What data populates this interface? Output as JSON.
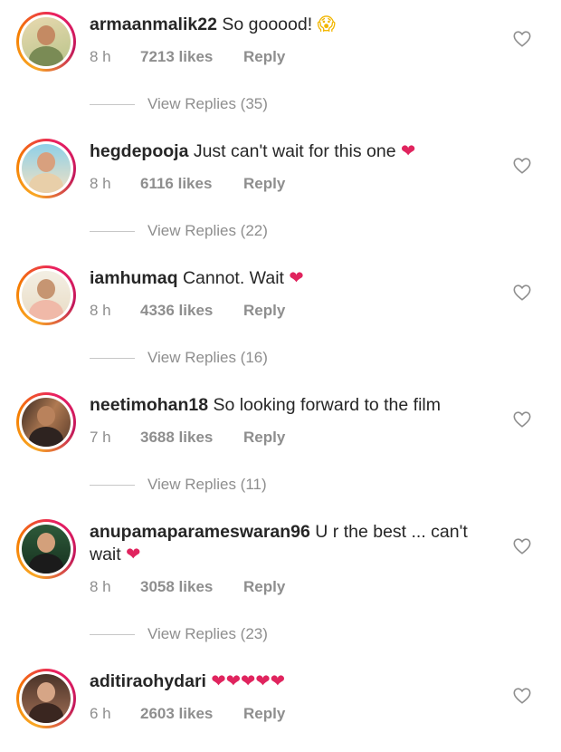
{
  "colors": {
    "heart": "#e0245e",
    "meta": "#8e8e8e",
    "text": "#262626"
  },
  "comments": [
    {
      "username": "armaanmalik22",
      "text": " So gooood! ",
      "emoji": "😱",
      "time": "8 h",
      "likes": "7213 likes",
      "reply": "Reply",
      "view_replies": "View Replies (35)"
    },
    {
      "username": "hegdepooja",
      "text": " Just can't wait for this one ",
      "emoji": "❤",
      "time": "8 h",
      "likes": "6116 likes",
      "reply": "Reply",
      "view_replies": "View Replies (22)"
    },
    {
      "username": "iamhumaq",
      "text": " Cannot. Wait ",
      "emoji": "❤",
      "time": "8 h",
      "likes": "4336 likes",
      "reply": "Reply",
      "view_replies": "View Replies (16)"
    },
    {
      "username": "neetimohan18",
      "text": " So looking forward to the film",
      "emoji": "",
      "time": "7 h",
      "likes": "3688 likes",
      "reply": "Reply",
      "view_replies": "View Replies (11)"
    },
    {
      "username": "anupamaparameswaran96",
      "text": " U r the best ... can't wait ",
      "emoji": "❤",
      "time": "8 h",
      "likes": "3058 likes",
      "reply": "Reply",
      "view_replies": "View Replies (23)"
    },
    {
      "username": "aditiraohydari",
      "text": " ",
      "emoji": "❤❤❤❤❤",
      "time": "6 h",
      "likes": "2603 likes",
      "reply": "Reply",
      "view_replies": ""
    }
  ]
}
